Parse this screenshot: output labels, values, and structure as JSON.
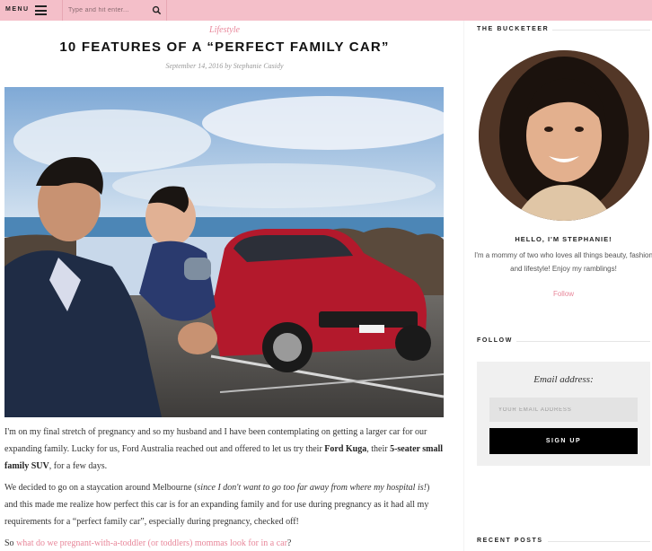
{
  "topbar": {
    "menu_label": "MENU",
    "search_placeholder": "Type and hit enter...",
    "colors": {
      "bar": "#f4bfc9"
    }
  },
  "post": {
    "category": "Lifestyle",
    "title": "10 FEATURES OF A “PERFECT FAMILY CAR”",
    "meta": "September 14, 2016 by Stephanie Casidy",
    "image_icon": "hero-photo-family-car",
    "p1": {
      "t1": "I'm on my final stretch of pregnancy and so my husband and I have been contemplating on getting a larger car for our expanding family. Lucky for us, Ford Australia reached out and offered to let us try their ",
      "b1": "Ford Kuga",
      "t2": ", their ",
      "b2": "5-seater small family SUV",
      "t3": ", for a few days."
    },
    "p2": {
      "t1": "We decided to go on a staycation around Melbourne (",
      "i1": "since I don't want to go too far away from where my hospital is!",
      "t2": ") and this made me realize how perfect this car is for an expanding family and for use during pregnancy as it had all my requirements for a “perfect family car”, especially during pregnancy, checked off!"
    },
    "p3": {
      "t1": "So ",
      "link": "what do we pregnant-with-a-toddler (or toddlers) mommas look for in a car",
      "t2": "?"
    },
    "accent_color": "#e8879a"
  },
  "sidebar": {
    "about_heading": "THE BUCKETEER",
    "hello": "HELLO, I'M STEPHANIE!",
    "bio": "I'm a mommy of two who loves all things beauty, fashion and lifestyle! Enjoy my ramblings!",
    "follow_link": "Follow",
    "follow_heading": "FOLLOW",
    "email_label": "Email address:",
    "email_placeholder": "YOUR EMAIL ADDRESS",
    "signup_label": "SIGN UP",
    "recent_heading": "RECENT POSTS"
  }
}
